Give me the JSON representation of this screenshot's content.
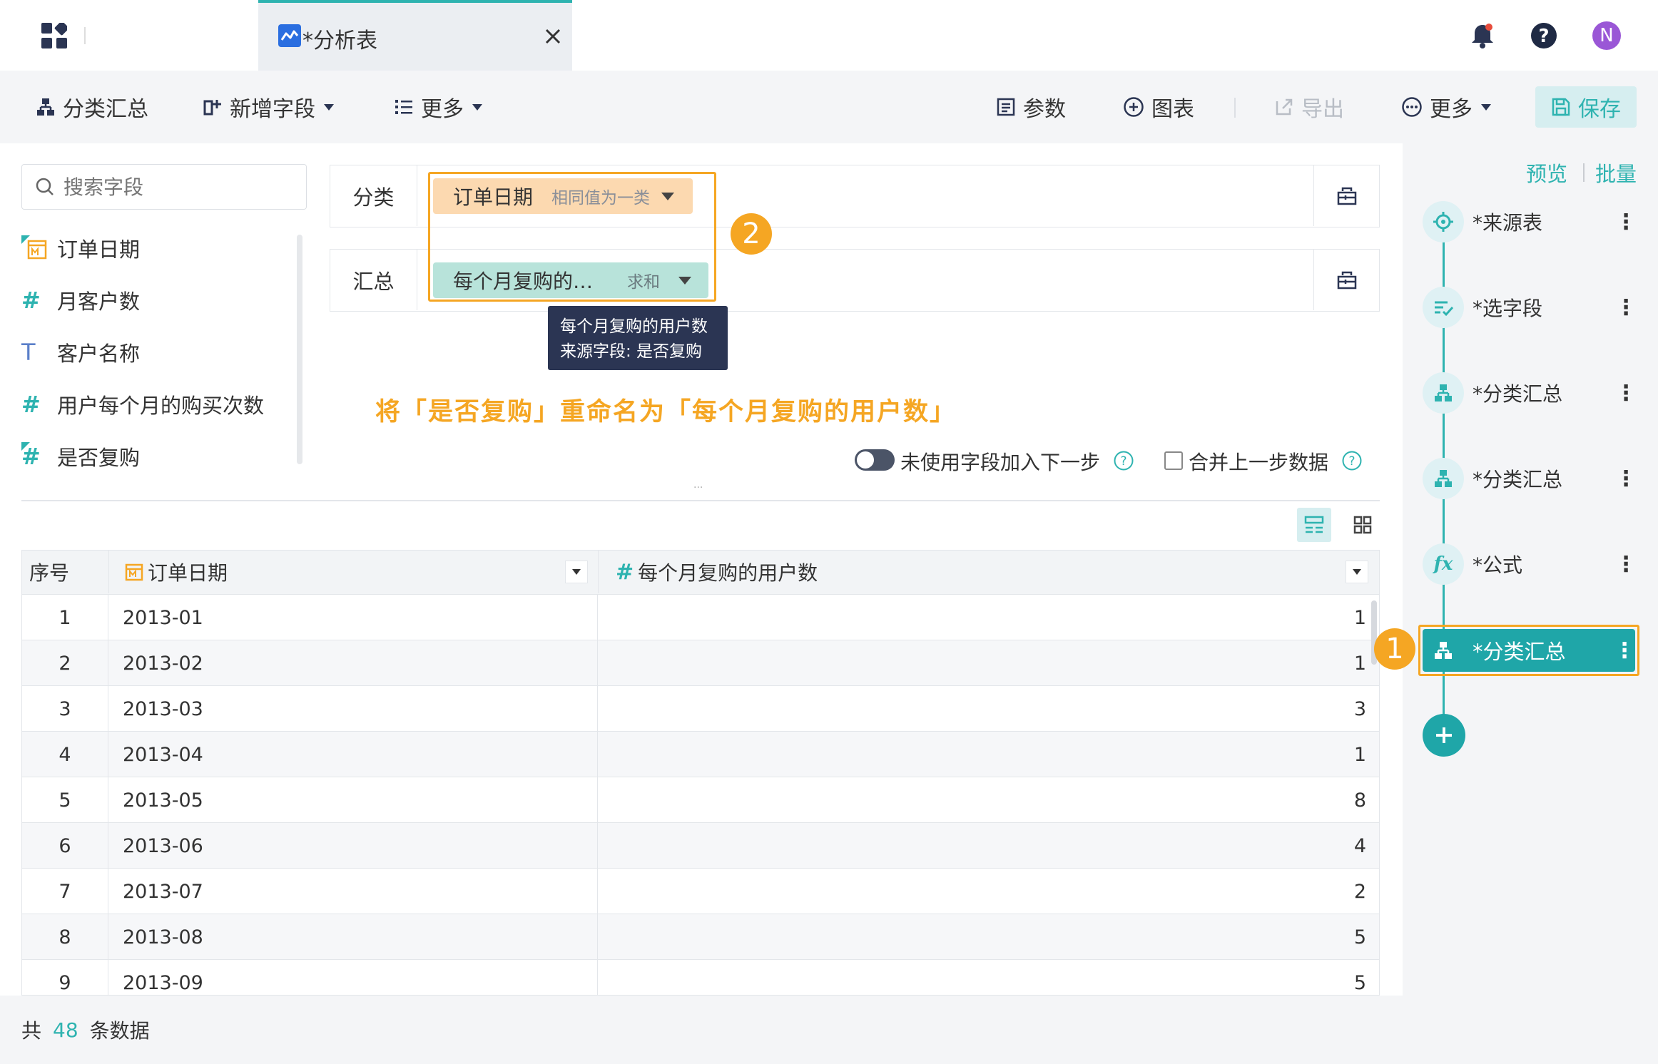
{
  "topbar": {
    "tab_title": "*分析表",
    "avatar_letter": "N"
  },
  "toolbar": {
    "group_summary": "分类汇总",
    "add_field": "新增字段",
    "more_left": "更多",
    "params": "参数",
    "chart": "图表",
    "export": "导出",
    "more_right": "更多",
    "save": "保存"
  },
  "fields_panel": {
    "search_placeholder": "搜索字段",
    "fields": [
      {
        "name": "订单日期",
        "type": "date"
      },
      {
        "name": "月客户数",
        "type": "number"
      },
      {
        "name": "客户名称",
        "type": "text"
      },
      {
        "name": "用户每个月的购买次数",
        "type": "number"
      },
      {
        "name": "是否复购",
        "type": "number"
      }
    ]
  },
  "config": {
    "category_label": "分类",
    "category_chip": "订单日期",
    "category_mode": "相同值为一类",
    "summary_label": "汇总",
    "summary_chip": "每个月复购的…",
    "summary_mode": "求和",
    "tooltip_line1": "每个月复购的用户数",
    "tooltip_line2": "来源字段: 是否复购",
    "annotation": "将「是否复购」重命名为「每个月复购的用户数」",
    "badge1": "1",
    "badge2": "2",
    "toggle_label": "未使用字段加入下一步",
    "merge_label": "合并上一步数据"
  },
  "table": {
    "headers": [
      "序号",
      "订单日期",
      "每个月复购的用户数"
    ],
    "rows": [
      [
        "1",
        "2013-01",
        "1"
      ],
      [
        "2",
        "2013-02",
        "1"
      ],
      [
        "3",
        "2013-03",
        "3"
      ],
      [
        "4",
        "2013-04",
        "1"
      ],
      [
        "5",
        "2013-05",
        "8"
      ],
      [
        "6",
        "2013-06",
        "4"
      ],
      [
        "7",
        "2013-07",
        "2"
      ],
      [
        "8",
        "2013-08",
        "5"
      ],
      [
        "9",
        "2013-09",
        "5"
      ]
    ],
    "footer_prefix": "共",
    "footer_count": "48",
    "footer_suffix": "条数据"
  },
  "steps_panel": {
    "preview": "预览",
    "batch": "批量",
    "nodes": [
      {
        "label": "*来源表",
        "icon": "source-icon"
      },
      {
        "label": "*选字段",
        "icon": "select-field-icon"
      },
      {
        "label": "*分类汇总",
        "icon": "group-icon"
      },
      {
        "label": "*分类汇总",
        "icon": "group-icon"
      },
      {
        "label": "*公式",
        "icon": "formula-icon"
      },
      {
        "label": "*分类汇总",
        "icon": "group-icon",
        "active": true
      }
    ]
  },
  "colors": {
    "accent": "#2eb3b0",
    "highlight": "#f5a623",
    "tooltip_bg": "#2b3553"
  }
}
